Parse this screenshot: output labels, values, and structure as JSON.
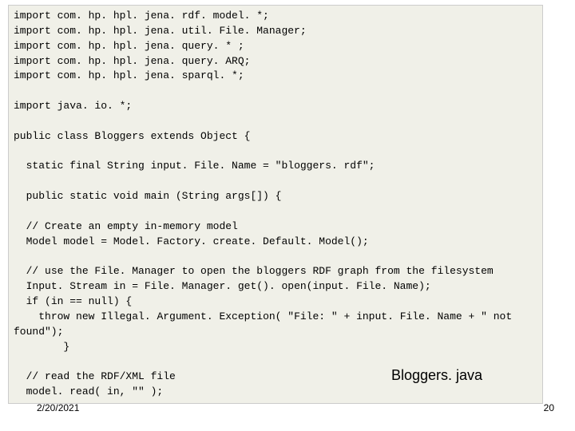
{
  "code": "import com. hp. hpl. jena. rdf. model. *;\nimport com. hp. hpl. jena. util. File. Manager;\nimport com. hp. hpl. jena. query. * ;\nimport com. hp. hpl. jena. query. ARQ;\nimport com. hp. hpl. jena. sparql. *;\n\nimport java. io. *;\n\npublic class Bloggers extends Object {\n\n  static final String input. File. Name = \"bloggers. rdf\";\n\n  public static void main (String args[]) {\n\n  // Create an empty in-memory model\n  Model model = Model. Factory. create. Default. Model();\n\n  // use the File. Manager to open the bloggers RDF graph from the filesystem\n  Input. Stream in = File. Manager. get(). open(input. File. Name);\n  if (in == null) {\n    throw new Illegal. Argument. Exception( \"File: \" + input. File. Name + \" not found\");\n        }\n\n  // read the RDF/XML file\n  model. read( in, \"\" );",
  "caption": "Bloggers. java",
  "date": "2/20/2021",
  "pagenum": "20"
}
